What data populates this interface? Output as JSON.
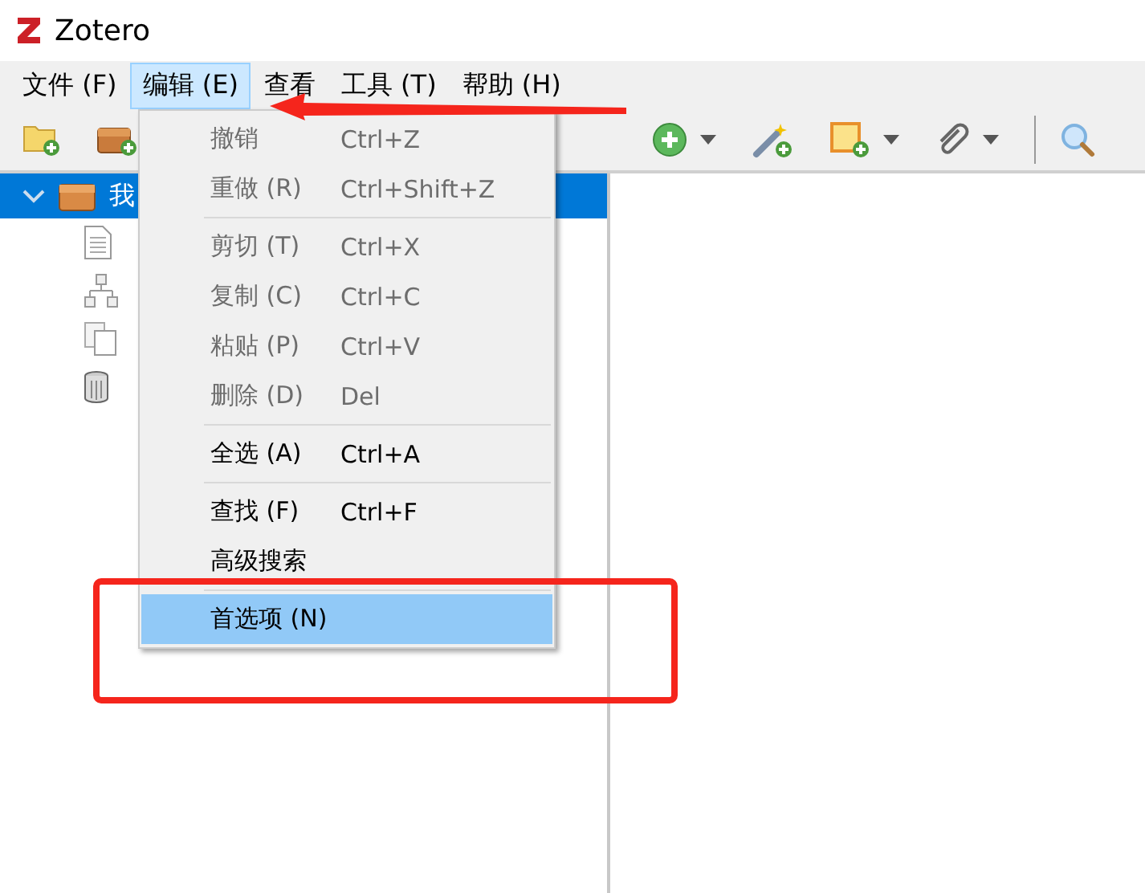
{
  "window": {
    "title": "Zotero"
  },
  "menu_bar": [
    {
      "label": "文件 (F)",
      "selected": false
    },
    {
      "label": "编辑 (E)",
      "selected": true
    },
    {
      "label": "查看",
      "selected": false
    },
    {
      "label": "工具 (T)",
      "selected": false
    },
    {
      "label": "帮助 (H)",
      "selected": false
    }
  ],
  "toolbar": [
    {
      "kind": "new-collection"
    },
    {
      "kind": "new-library"
    },
    {
      "kind": "new-item",
      "dropdown": true
    },
    {
      "kind": "add-by-identifier",
      "dropdown": false
    },
    {
      "kind": "new-note",
      "dropdown": true
    },
    {
      "kind": "attachment",
      "dropdown": true
    },
    {
      "kind": "separator"
    },
    {
      "kind": "search",
      "dropdown": false
    }
  ],
  "tree": [
    {
      "kind": "library",
      "label": "我",
      "selected": true,
      "expanded": true,
      "children": [
        {
          "kind": "document"
        },
        {
          "kind": "hierarchy"
        },
        {
          "kind": "duplicates"
        },
        {
          "kind": "trash"
        }
      ]
    }
  ],
  "edit_menu": [
    {
      "kind": "item",
      "label": "撤销",
      "shortcut": "Ctrl+Z",
      "disabled": true,
      "selected": false
    },
    {
      "kind": "item",
      "label": "重做 (R)",
      "shortcut": "Ctrl+Shift+Z",
      "disabled": true,
      "selected": false
    },
    {
      "kind": "separator"
    },
    {
      "kind": "item",
      "label": "剪切 (T)",
      "shortcut": "Ctrl+X",
      "disabled": true,
      "selected": false
    },
    {
      "kind": "item",
      "label": "复制 (C)",
      "shortcut": "Ctrl+C",
      "disabled": true,
      "selected": false
    },
    {
      "kind": "item",
      "label": "粘贴 (P)",
      "shortcut": "Ctrl+V",
      "disabled": true,
      "selected": false
    },
    {
      "kind": "item",
      "label": "删除 (D)",
      "shortcut": "Del",
      "disabled": true,
      "selected": false
    },
    {
      "kind": "separator"
    },
    {
      "kind": "item",
      "label": "全选 (A)",
      "shortcut": "Ctrl+A",
      "disabled": false,
      "selected": false
    },
    {
      "kind": "separator"
    },
    {
      "kind": "item",
      "label": "查找 (F)",
      "shortcut": "Ctrl+F",
      "disabled": false,
      "selected": false
    },
    {
      "kind": "item",
      "label": "高级搜索",
      "disabled": false,
      "selected": false
    },
    {
      "kind": "separator"
    },
    {
      "kind": "item",
      "label": "首选项 (N)",
      "disabled": false,
      "selected": true
    }
  ]
}
